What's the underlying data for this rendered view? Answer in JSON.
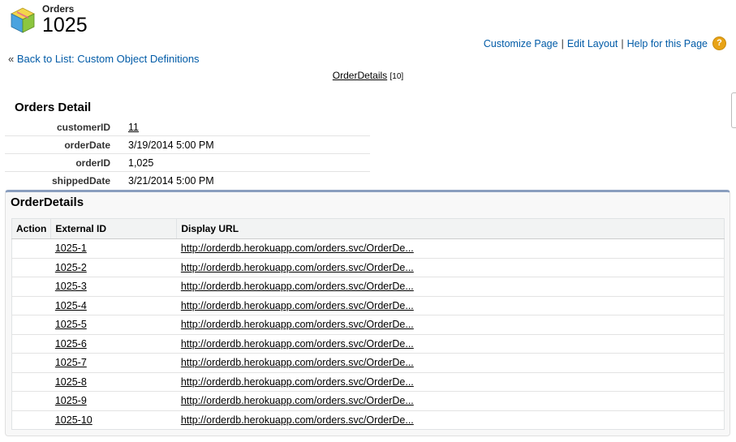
{
  "header": {
    "object_type": "Orders",
    "record_name": "1025"
  },
  "top_links": {
    "customize": "Customize Page",
    "separator": "|",
    "edit_layout": "Edit Layout",
    "help": "Help for this Page",
    "help_icon": "?"
  },
  "back": {
    "prefix": "«",
    "label": "Back to List: Custom Object Definitions"
  },
  "related_hover": {
    "label": "OrderDetails",
    "count": "[10]"
  },
  "detail": {
    "title": "Orders Detail",
    "fields": {
      "customer_id": {
        "label": "customerID",
        "value": "11"
      },
      "order_date": {
        "label": "orderDate",
        "value": "3/19/2014 5:00 PM"
      },
      "order_id": {
        "label": "orderID",
        "value": "1,025"
      },
      "shipped_date": {
        "label": "shippedDate",
        "value": "3/21/2014 5:00 PM"
      }
    }
  },
  "related_list": {
    "title": "OrderDetails",
    "columns": [
      "Action",
      "External ID",
      "Display URL"
    ],
    "rows": [
      {
        "action": "",
        "external_id": "1025-1",
        "url": "http://orderdb.herokuapp.com/orders.svc/OrderDe..."
      },
      {
        "action": "",
        "external_id": "1025-2",
        "url": "http://orderdb.herokuapp.com/orders.svc/OrderDe..."
      },
      {
        "action": "",
        "external_id": "1025-3",
        "url": "http://orderdb.herokuapp.com/orders.svc/OrderDe..."
      },
      {
        "action": "",
        "external_id": "1025-4",
        "url": "http://orderdb.herokuapp.com/orders.svc/OrderDe..."
      },
      {
        "action": "",
        "external_id": "1025-5",
        "url": "http://orderdb.herokuapp.com/orders.svc/OrderDe..."
      },
      {
        "action": "",
        "external_id": "1025-6",
        "url": "http://orderdb.herokuapp.com/orders.svc/OrderDe..."
      },
      {
        "action": "",
        "external_id": "1025-7",
        "url": "http://orderdb.herokuapp.com/orders.svc/OrderDe..."
      },
      {
        "action": "",
        "external_id": "1025-8",
        "url": "http://orderdb.herokuapp.com/orders.svc/OrderDe..."
      },
      {
        "action": "",
        "external_id": "1025-9",
        "url": "http://orderdb.herokuapp.com/orders.svc/OrderDe..."
      },
      {
        "action": "",
        "external_id": "1025-10",
        "url": "http://orderdb.herokuapp.com/orders.svc/OrderDe..."
      }
    ]
  },
  "colors": {
    "link": "#015ba7",
    "help_icon": "#e8a316",
    "section_border": "#8a9ebe"
  },
  "icons": [
    "cube-icon",
    "help-icon"
  ]
}
